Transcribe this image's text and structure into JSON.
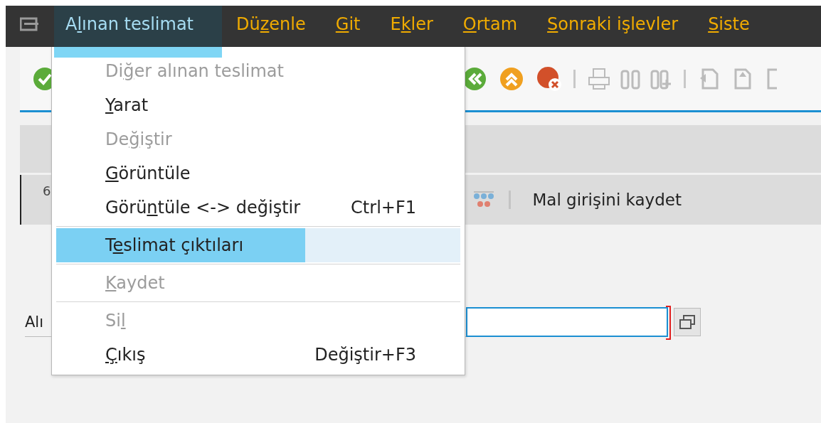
{
  "menubar": {
    "items": [
      {
        "pre": "A",
        "key": "l",
        "post": "ınan teslimat",
        "selected": true
      },
      {
        "pre": "Dü",
        "key": "z",
        "post": "enle",
        "selected": false
      },
      {
        "key": "G",
        "post": "it",
        "selected": false
      },
      {
        "pre": "E",
        "key": "k",
        "post": "ler",
        "selected": false
      },
      {
        "key": "O",
        "post": "rtam",
        "selected": false
      },
      {
        "key": "S",
        "post": "onraki işlevler",
        "selected": false
      },
      {
        "key": "S",
        "post": "iste",
        "selected": false
      }
    ]
  },
  "dropdown": {
    "items": [
      {
        "kind": "item",
        "pre": "Di",
        "key": "ğ",
        "post": "er alınan teslimat",
        "disabled": true,
        "selected": false
      },
      {
        "kind": "item",
        "key": "Y",
        "post": "arat",
        "disabled": false,
        "selected": false
      },
      {
        "kind": "item",
        "pre": "De",
        "key": "ğ",
        "post": "iştir",
        "disabled": true,
        "selected": false
      },
      {
        "kind": "item",
        "key": "G",
        "post": "örüntüle",
        "disabled": false,
        "selected": false
      },
      {
        "kind": "item",
        "pre": "Görü",
        "key": "n",
        "post": "tüle <-> değiştir",
        "shortcut": "Ctrl+F1",
        "disabled": false,
        "selected": false
      },
      {
        "kind": "separator"
      },
      {
        "kind": "item",
        "pre": "T",
        "key": "e",
        "post": "slimat çıktıları",
        "disabled": false,
        "selected": true
      },
      {
        "kind": "separator"
      },
      {
        "kind": "item",
        "key": "K",
        "post": "aydet",
        "disabled": true,
        "selected": false
      },
      {
        "kind": "separator"
      },
      {
        "kind": "item",
        "pre": "Si",
        "key": "l",
        "disabled": true,
        "selected": false
      },
      {
        "kind": "item",
        "key": "Ç",
        "post": "ıkış",
        "shortcut": "Değiştir+F3",
        "disabled": false,
        "selected": false
      }
    ]
  },
  "screen": {
    "row": {
      "number": "6",
      "text": "Mal girişini kaydet"
    },
    "field": {
      "label": "Alı"
    }
  }
}
